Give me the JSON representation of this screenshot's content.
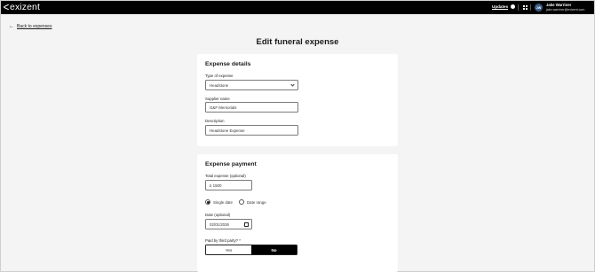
{
  "topbar": {
    "logo": "exizent",
    "updates_label": "Updates",
    "user": {
      "initials": "JW",
      "name": "Jake Warriner",
      "email": "jake.warriner@exizent.com"
    }
  },
  "back_link": "Back to expenses",
  "page_title": "Edit funeral expense",
  "expense_details": {
    "heading": "Expense details",
    "type_label": "Type of expense",
    "type_value": "Headstone",
    "supplier_label": "Supplier name",
    "supplier_value": "G&F Memorials",
    "description_label": "Description",
    "description_value": "Headstone Expense"
  },
  "expense_payment": {
    "heading": "Expense payment",
    "total_label": "Total expense (optional)",
    "total_value": "£ 1500",
    "radio_single": "Single date",
    "radio_range": "Date range",
    "radio_selected": "Single date",
    "date_label": "Date (optional)",
    "date_value": "02/01/2026",
    "third_party_label": "Paid by third party? *",
    "yes_label": "Yes",
    "no_label": "No",
    "selected": "No"
  }
}
